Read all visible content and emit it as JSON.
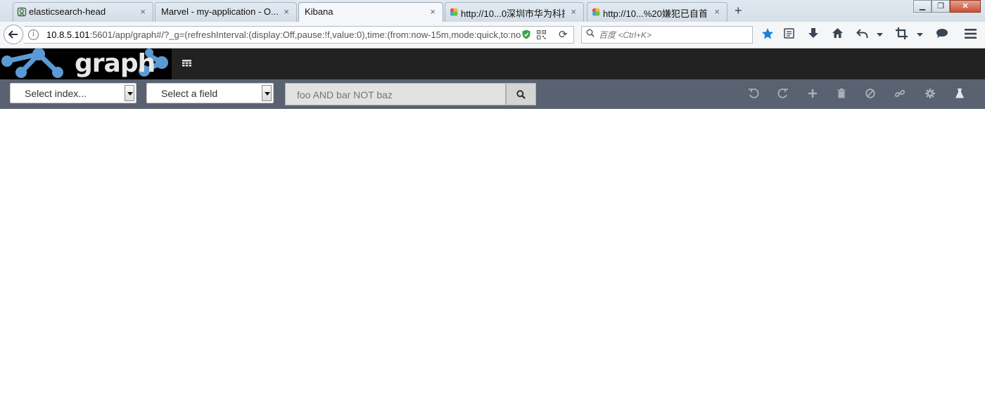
{
  "tabs": [
    {
      "title": "elasticsearch-head",
      "icon": "elasticsearch-head-icon",
      "active": false
    },
    {
      "title": "Marvel - my-application - O...",
      "icon": "",
      "active": false
    },
    {
      "title": "Kibana",
      "icon": "",
      "active": true
    },
    {
      "title": "http://10...0深圳市华为科技",
      "icon": "colorful-favicon",
      "active": false
    },
    {
      "title": "http://10...%20嫌犯已自首",
      "icon": "colorful-favicon",
      "active": false
    }
  ],
  "tab_close_glyph": "×",
  "new_tab_glyph": "+",
  "window_controls": {
    "minimize": "▁",
    "restore": "❐",
    "close": "✕"
  },
  "address": {
    "host": "10.8.5.101",
    "rest": ":5601/app/graph#/?_g=(refreshInterval:(display:Off,pause:!f,value:0),time:(from:now-15m,mode:quick,to:no"
  },
  "search": {
    "placeholder": "百度 <Ctrl+K>"
  },
  "kibana": {
    "logo_text": "graph"
  },
  "graph_toolbar": {
    "index_select": "Select index...",
    "field_select": "Select a field",
    "query_placeholder": "foo AND bar NOT baz"
  },
  "colors": {
    "header_bg": "#222222",
    "toolbar_bg": "#5a6271",
    "star_blue": "#1a7fd6"
  }
}
